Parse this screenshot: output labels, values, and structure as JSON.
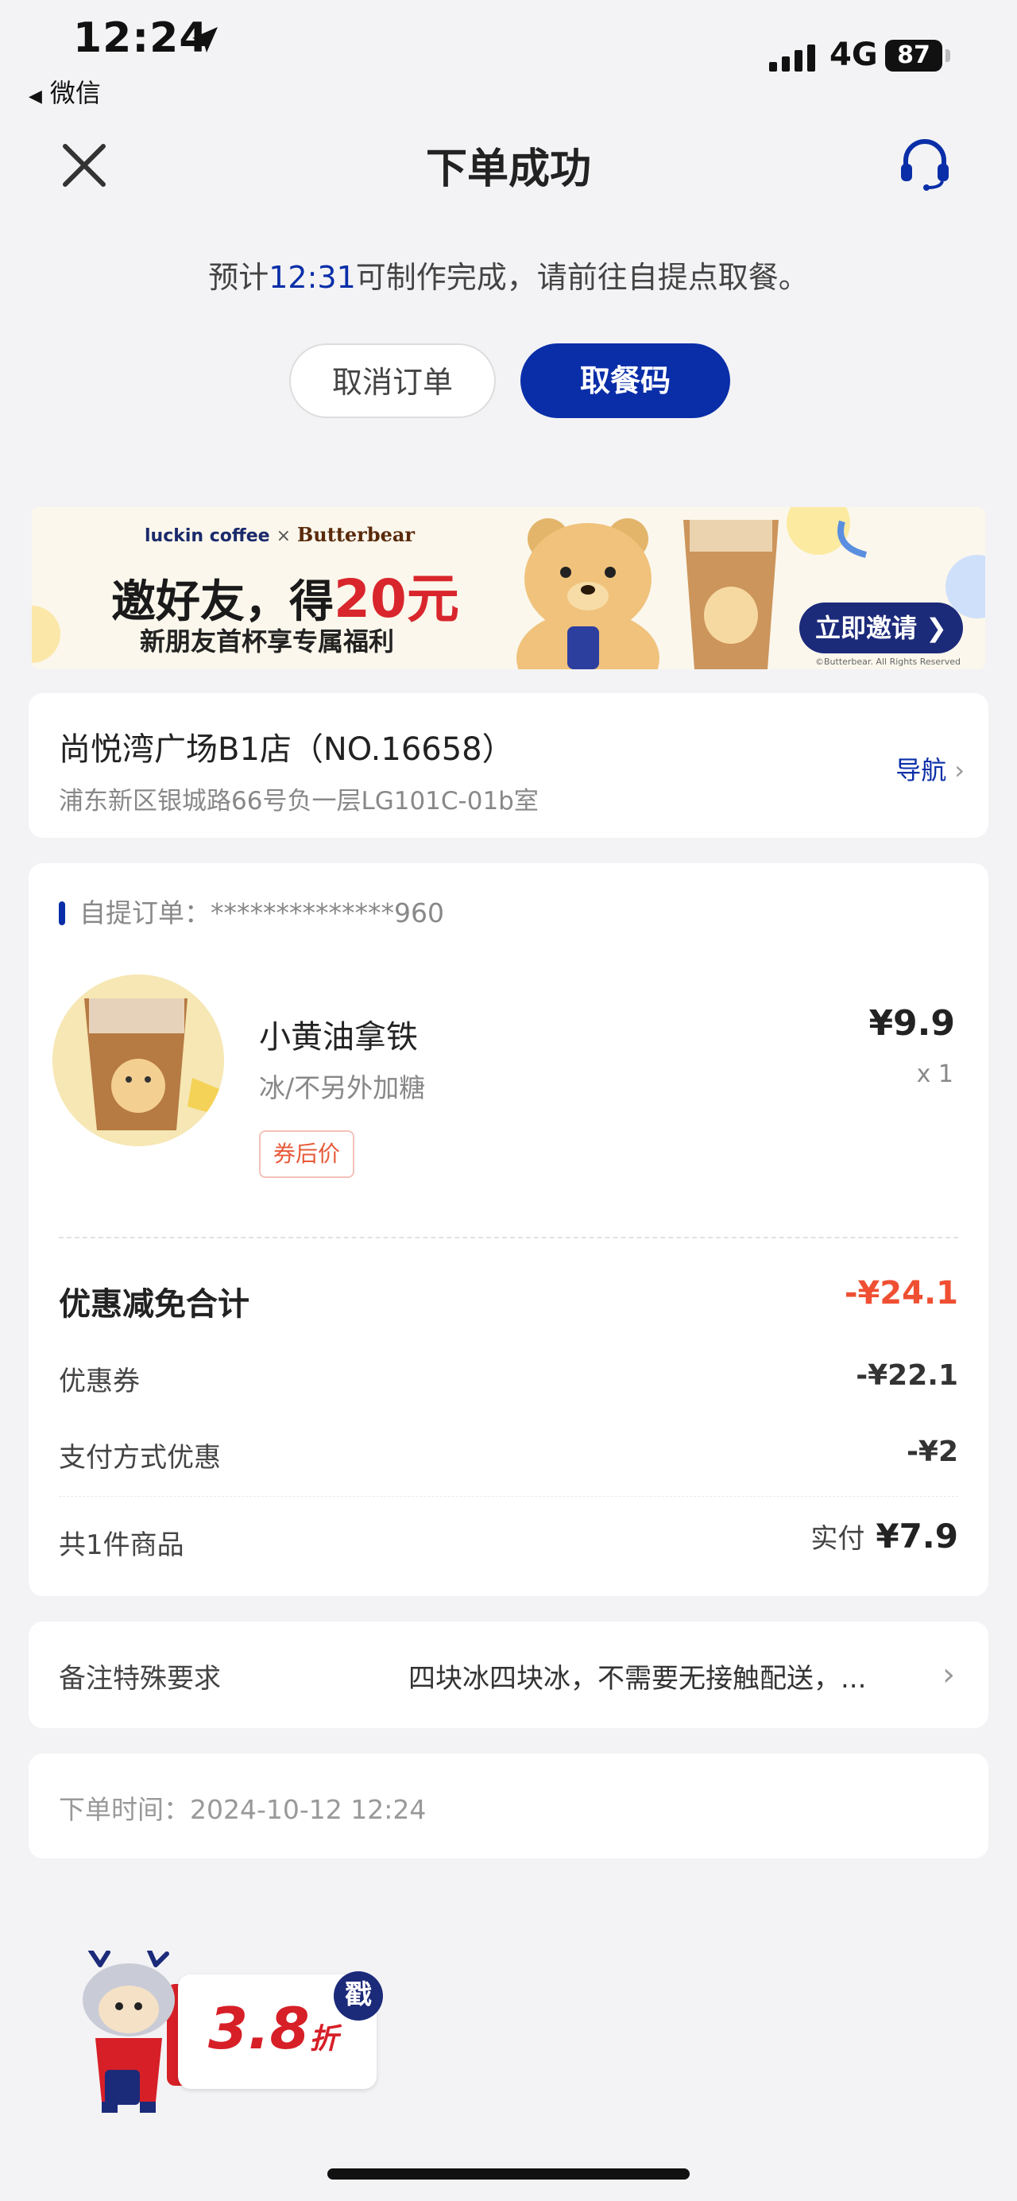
{
  "status_bar": {
    "time": "12:24",
    "back_app": "微信",
    "network": "4G",
    "battery": "87"
  },
  "header": {
    "title": "下单成功"
  },
  "eta": {
    "prefix": "预计",
    "time": "12:31",
    "suffix": "可制作完成，请前往自提点取餐。"
  },
  "actions": {
    "cancel_label": "取消订单",
    "pickup_code_label": "取餐码"
  },
  "banner": {
    "brand_left": "luckin coffee",
    "brand_x": "×",
    "brand_right": "Butterbear",
    "title_prefix": "邀好友，得",
    "title_amount": "20元",
    "subtitle": "新朋友首杯享专属福利",
    "cta": "立即邀请",
    "cta_chevron": "❯",
    "copyright": "©Butterbear. All Rights Reserved"
  },
  "store": {
    "name": "尚悦湾广场B1店（NO.16658）",
    "address": "浦东新区银城路66号负一层LG101C-01b室",
    "nav_label": "导航",
    "nav_chevron": "›"
  },
  "order": {
    "id_label": "自提订单：",
    "id_value": "**************960",
    "product": {
      "name": "小黄油拿铁",
      "spec": "冰/不另外加糖",
      "tag": "券后价",
      "price": "¥9.9",
      "qty": "x 1"
    },
    "discount_total_label": "优惠减免合计",
    "discount_total_value": "-¥24.1",
    "coupon_label": "优惠券",
    "coupon_value": "-¥22.1",
    "payment_discount_label": "支付方式优惠",
    "payment_discount_value": "-¥2",
    "item_count": "共1件商品",
    "paid_label": "实付",
    "paid_value": "¥7.9"
  },
  "remark": {
    "label": "备注特殊要求",
    "text": "四块冰四块冰，不需要无接触配送，...",
    "chevron": "›"
  },
  "order_time": {
    "label": "下单时间：",
    "value": "2024-10-12 12:24"
  },
  "promo": {
    "value": "3.8",
    "unit": "折",
    "badge": "戳"
  },
  "colors": {
    "brand_blue": "#0a2ea8",
    "discount_red": "#ef4f32",
    "background": "#f3f3f5"
  }
}
